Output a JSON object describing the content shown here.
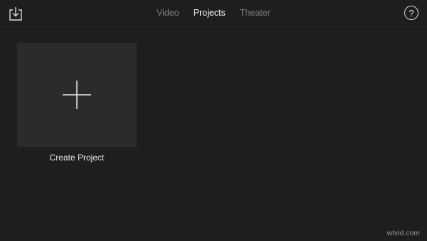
{
  "toolbar": {
    "import_icon": "download-tray-icon",
    "help_icon": "question-circle-icon",
    "help_glyph": "?"
  },
  "tabs": [
    {
      "label": "Video",
      "active": false
    },
    {
      "label": "Projects",
      "active": true
    },
    {
      "label": "Theater",
      "active": false
    }
  ],
  "projects": {
    "create_label": "Create Project",
    "create_icon": "plus-icon"
  },
  "watermark": "wtvid.com",
  "colors": {
    "background": "#1e1e1e",
    "tile": "#2b2b2b",
    "active_tab": "#f2f2f2",
    "inactive_tab": "#7d7d7d"
  }
}
